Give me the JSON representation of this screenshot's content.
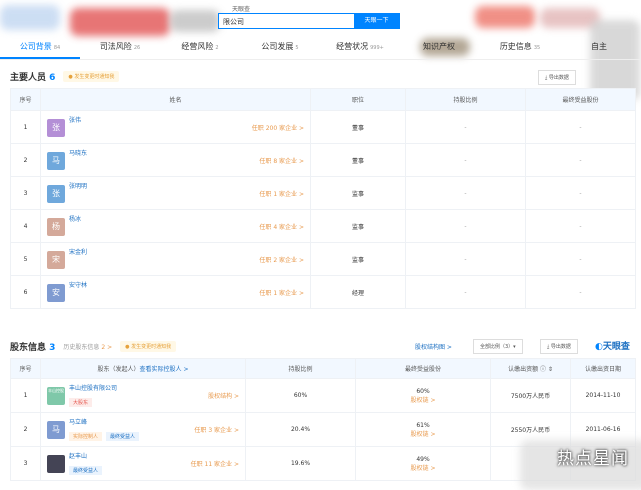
{
  "search": {
    "label": "天眼查",
    "value": "限公司",
    "button": "天眼一下"
  },
  "tabs": [
    {
      "label": "公司背景",
      "count": "84"
    },
    {
      "label": "司法风险",
      "count": "26"
    },
    {
      "label": "经营风险",
      "count": "2"
    },
    {
      "label": "公司发展",
      "count": "5"
    },
    {
      "label": "经营状况",
      "count": "999+"
    },
    {
      "label": "知识产权",
      "count": ""
    },
    {
      "label": "历史信息",
      "count": "35"
    },
    {
      "label": "自主",
      "count": ""
    }
  ],
  "personnel": {
    "title": "主要人员",
    "count": "6",
    "badge": "发生变更时通知我",
    "export": "导出数据",
    "headers": [
      "序号",
      "姓名",
      "职位",
      "持股比例",
      "最终受益股份"
    ],
    "rows": [
      {
        "no": "1",
        "avatar": "张",
        "name": "张伟",
        "link": "任职 200 家企业 >",
        "role": "董事",
        "ratio": "-",
        "benefit": "-",
        "color": "#b48fd6"
      },
      {
        "no": "2",
        "avatar": "马",
        "name": "马晓东",
        "link": "任职 8 家企业 >",
        "role": "董事",
        "ratio": "-",
        "benefit": "-",
        "color": "#6fa8dc"
      },
      {
        "no": "3",
        "avatar": "张",
        "name": "张明明",
        "link": "任职 1 家企业 >",
        "role": "监事",
        "ratio": "-",
        "benefit": "-",
        "color": "#6fa8dc"
      },
      {
        "no": "4",
        "avatar": "杨",
        "name": "杨冰",
        "link": "任职 4 家企业 >",
        "role": "监事",
        "ratio": "-",
        "benefit": "-",
        "color": "#d4a99a"
      },
      {
        "no": "5",
        "avatar": "宋",
        "name": "宋金利",
        "link": "任职 2 家企业 >",
        "role": "监事",
        "ratio": "-",
        "benefit": "-",
        "color": "#d4a99a"
      },
      {
        "no": "6",
        "avatar": "安",
        "name": "安守林",
        "link": "任职 1 家企业 >",
        "role": "经理",
        "ratio": "-",
        "benefit": "-",
        "color": "#7f9bd1"
      }
    ]
  },
  "shareholders": {
    "title": "股东信息",
    "count": "3",
    "history": "历史股东信息",
    "history_count": "2 >",
    "badge": "发生变更时通知我",
    "structure_link": "股权结构图 >",
    "filter": "全部比例（3）▾",
    "export": "导出数据",
    "brand": "天眼查",
    "headers": [
      "序号",
      "股东（发起人）",
      "查看实际控股人 >",
      "持股比例",
      "最终受益股份",
      "认缴出资额 ⓘ ⇕",
      "认缴出资日期"
    ],
    "rows": [
      {
        "no": "1",
        "avatar": "丰山控股",
        "name": "丰山控股有限公司",
        "tags": [
          "大股东"
        ],
        "link": "股权结构 >",
        "ratio": "60%",
        "benefit": "60%",
        "chain": "股权链 >",
        "amount": "7500万人民币",
        "date": "2014-11-10",
        "color": "#7fc8a9"
      },
      {
        "no": "2",
        "avatar": "马",
        "name": "马立峰",
        "tags": [
          "实际控制人",
          "最终受益人"
        ],
        "link": "任职 3 家企业 >",
        "ratio": "20.4%",
        "benefit": "61%",
        "chain": "股权链 >",
        "amount": "2550万人民币",
        "date": "2011-06-16",
        "color": "#7f9bd1"
      },
      {
        "no": "3",
        "avatar": "",
        "name": "赵丰山",
        "tags": [
          "最终受益人"
        ],
        "link": "任职 11 家企业 >",
        "ratio": "19.6%",
        "benefit": "49%",
        "chain": "股权链 >",
        "amount": "",
        "date": "",
        "color": "#445"
      }
    ]
  },
  "watermark": "热点星闻"
}
